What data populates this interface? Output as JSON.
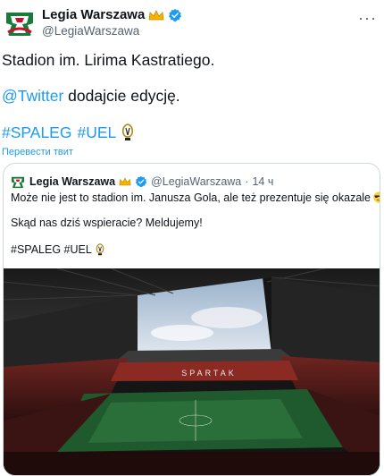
{
  "account": {
    "name": "Legia Warszawa",
    "handle": "@LegiaWarszawa"
  },
  "tweet": {
    "line1": "Stadion im. Lirima Kastratiego.",
    "mention": "@Twitter",
    "line2_rest": " dodajcie edycję.",
    "hashtag1": "#SPALEG",
    "hashtag2": "#UEL",
    "translate": "Перевести твит"
  },
  "quote": {
    "name": "Legia Warszawa",
    "handle": "@LegiaWarszawa",
    "dot": "·",
    "time": "14 ч",
    "p1": "Może nie jest to stadion im. Janusza Gola, ale też prezentuje się okazale",
    "p2": "Skąd nas dziś wspieracie? Meldujemy!",
    "p3": "#SPALEG #UEL"
  },
  "colors": {
    "link": "#1d9bf0",
    "verified": "#1d9bf0",
    "secondary_text": "#536471",
    "border": "#cfd9de"
  },
  "icons": [
    "legia-logo-icon",
    "crown-icon",
    "verified-icon",
    "more-icon",
    "trophy-icon",
    "sunglasses-emoji-icon"
  ]
}
